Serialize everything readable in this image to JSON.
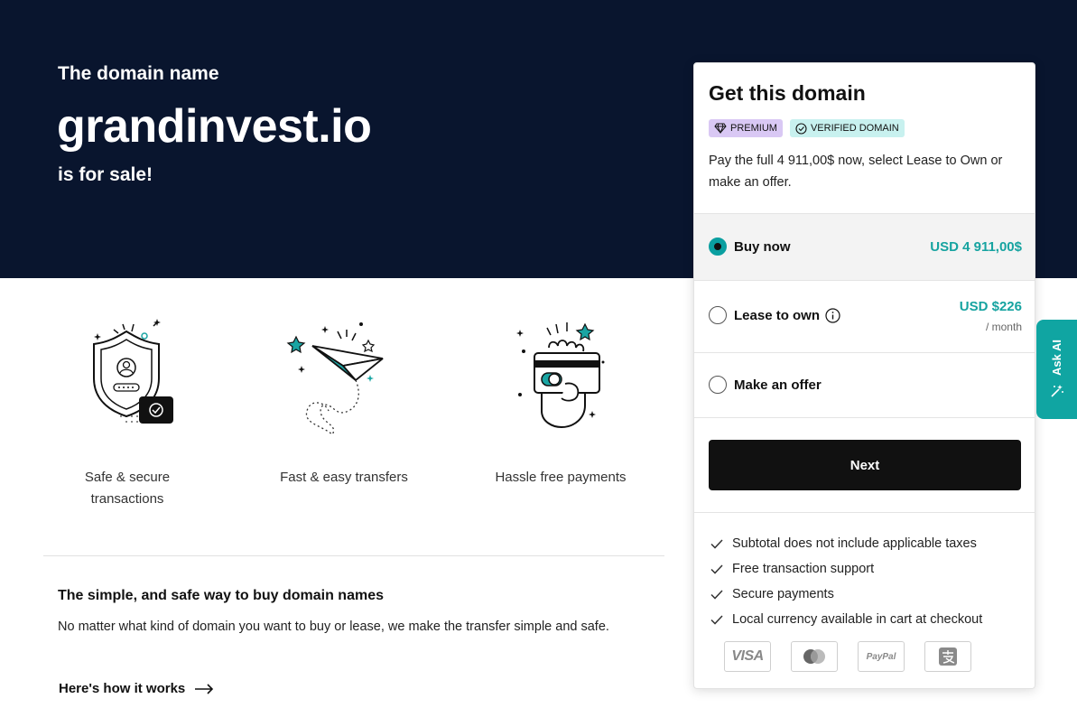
{
  "hero": {
    "pre": "The domain name",
    "domain": "grandinvest.io",
    "post": "is for sale!"
  },
  "features": [
    {
      "label": "Safe & secure transactions",
      "icon": "shield-user-icon"
    },
    {
      "label": "Fast & easy transfers",
      "icon": "paper-plane-icon"
    },
    {
      "label": "Hassle free payments",
      "icon": "hand-card-icon"
    }
  ],
  "info": {
    "title": "The simple, and safe way to buy domain names",
    "text": "No matter what kind of domain you want to buy or lease, we make the transfer simple and safe.",
    "link": "Here's how it works"
  },
  "card": {
    "title": "Get this domain",
    "badge_premium": "PREMIUM",
    "badge_verified": "VERIFIED DOMAIN",
    "description": "Pay the full 4 911,00$ now, select Lease to Own or make an offer.",
    "options": {
      "buy": {
        "label": "Buy now",
        "price": "USD 4 911,00$",
        "selected": true
      },
      "lease": {
        "label": "Lease to own",
        "price": "USD $226",
        "sub": "/ month",
        "selected": false
      },
      "offer": {
        "label": "Make an offer",
        "selected": false
      }
    },
    "next_label": "Next",
    "checks": [
      "Subtotal does not include applicable taxes",
      "Free transaction support",
      "Secure payments",
      "Local currency available in cart at checkout"
    ],
    "payment_methods": {
      "visa": "VISA",
      "mastercard": "mastercard-icon",
      "paypal": "PayPal",
      "alipay": "alipay-icon"
    }
  },
  "ask_ai": {
    "label": "Ask AI"
  },
  "colors": {
    "hero_bg": "#09152e",
    "accent_teal": "#16a3a0",
    "button_dark": "#111111",
    "premium_badge": "#d9c8f4",
    "verified_badge": "#c8f1ef"
  }
}
